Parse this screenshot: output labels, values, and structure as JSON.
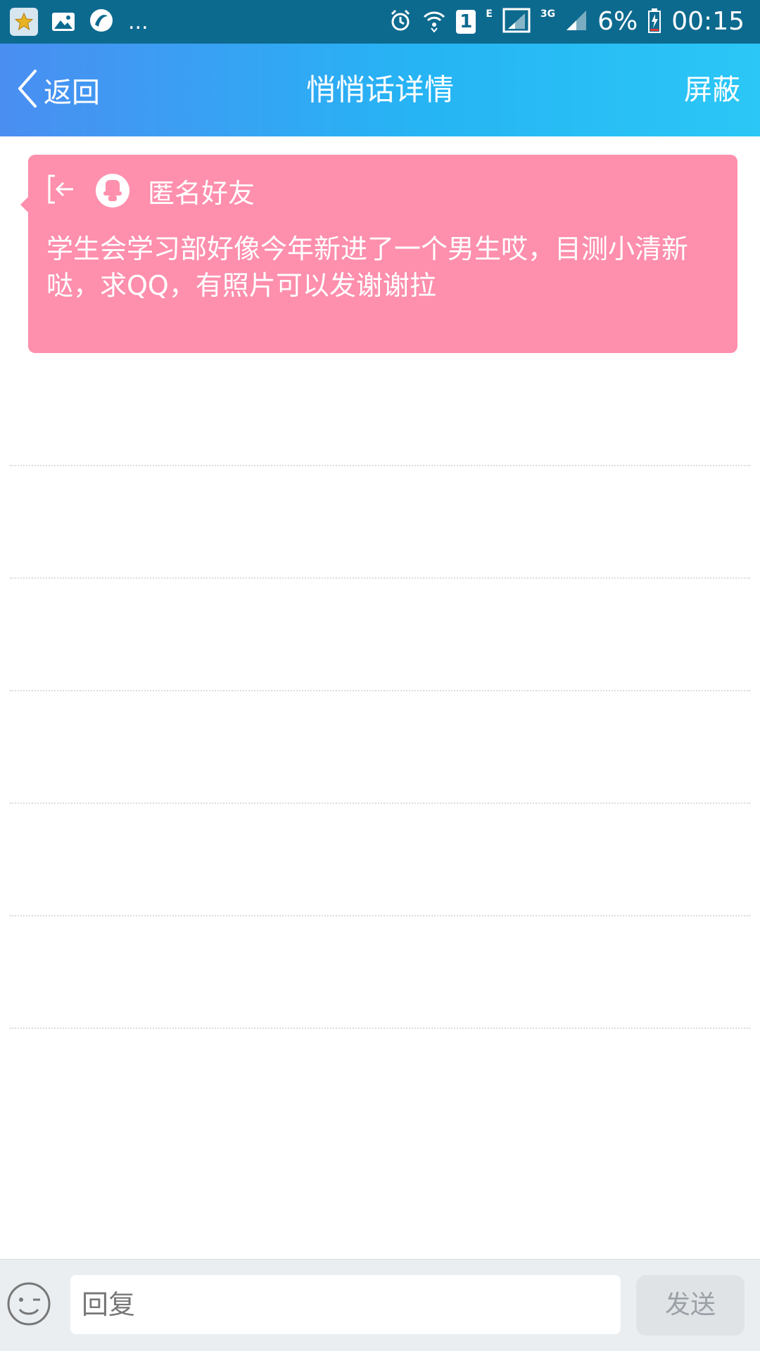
{
  "status_bar": {
    "left_icons": [
      "star-app-icon",
      "gallery-icon",
      "browser-icon"
    ],
    "more": "...",
    "sim_badge": "1",
    "network_e": "E",
    "network_3g": "3G",
    "battery": "6%",
    "time": "00:15"
  },
  "header": {
    "back_label": "返回",
    "title": "悄悄话详情",
    "block_label": "屏蔽"
  },
  "message": {
    "sender": "匿名好友",
    "text": "学生会学习部好像今年新进了一个男生哎，目测小清新哒，求QQ，有照片可以发谢谢拉"
  },
  "reply_bar": {
    "placeholder": "回复",
    "send_label": "发送"
  },
  "colors": {
    "status_bar": "#0d6a8f",
    "header_gradient_start": "#4a8ef2",
    "header_gradient_end": "#2bc7f6",
    "card": "#fe8fad",
    "send_disabled": "#dfe3e6"
  }
}
